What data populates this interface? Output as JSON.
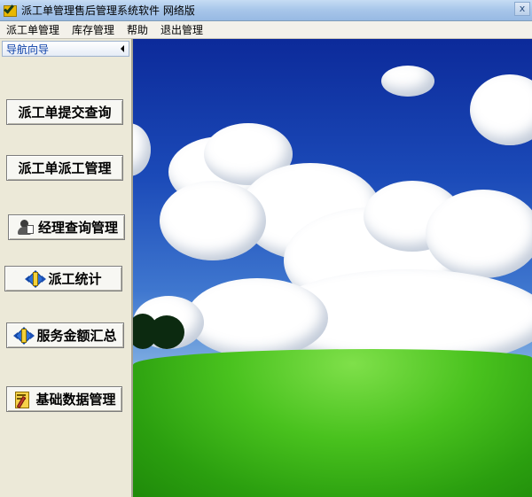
{
  "window": {
    "title": "派工单管理售后管理系统软件  网络版",
    "close_label": "x"
  },
  "menubar": {
    "items": [
      "派工单管理",
      "库存管理",
      "帮助",
      "退出管理"
    ]
  },
  "sidebar": {
    "title": "导航向导",
    "buttons": [
      {
        "label": "派工单提交查询",
        "icon": "none"
      },
      {
        "label": "派工单派工管理",
        "icon": "none"
      },
      {
        "label": "经理查询管理",
        "icon": "manager-icon"
      },
      {
        "label": "派工统计",
        "icon": "diamond-arrows-icon"
      },
      {
        "label": "服务金额汇总",
        "icon": "diamond-arrows-icon"
      },
      {
        "label": "基础数据管理",
        "icon": "data-edit-icon"
      }
    ]
  },
  "main": {
    "background": "sky-grass-wallpaper"
  },
  "colors": {
    "titlebar": "#a9c7ea",
    "sidebar_title": "#0a3fa8",
    "sidebar_bg": "#ece9d8"
  }
}
